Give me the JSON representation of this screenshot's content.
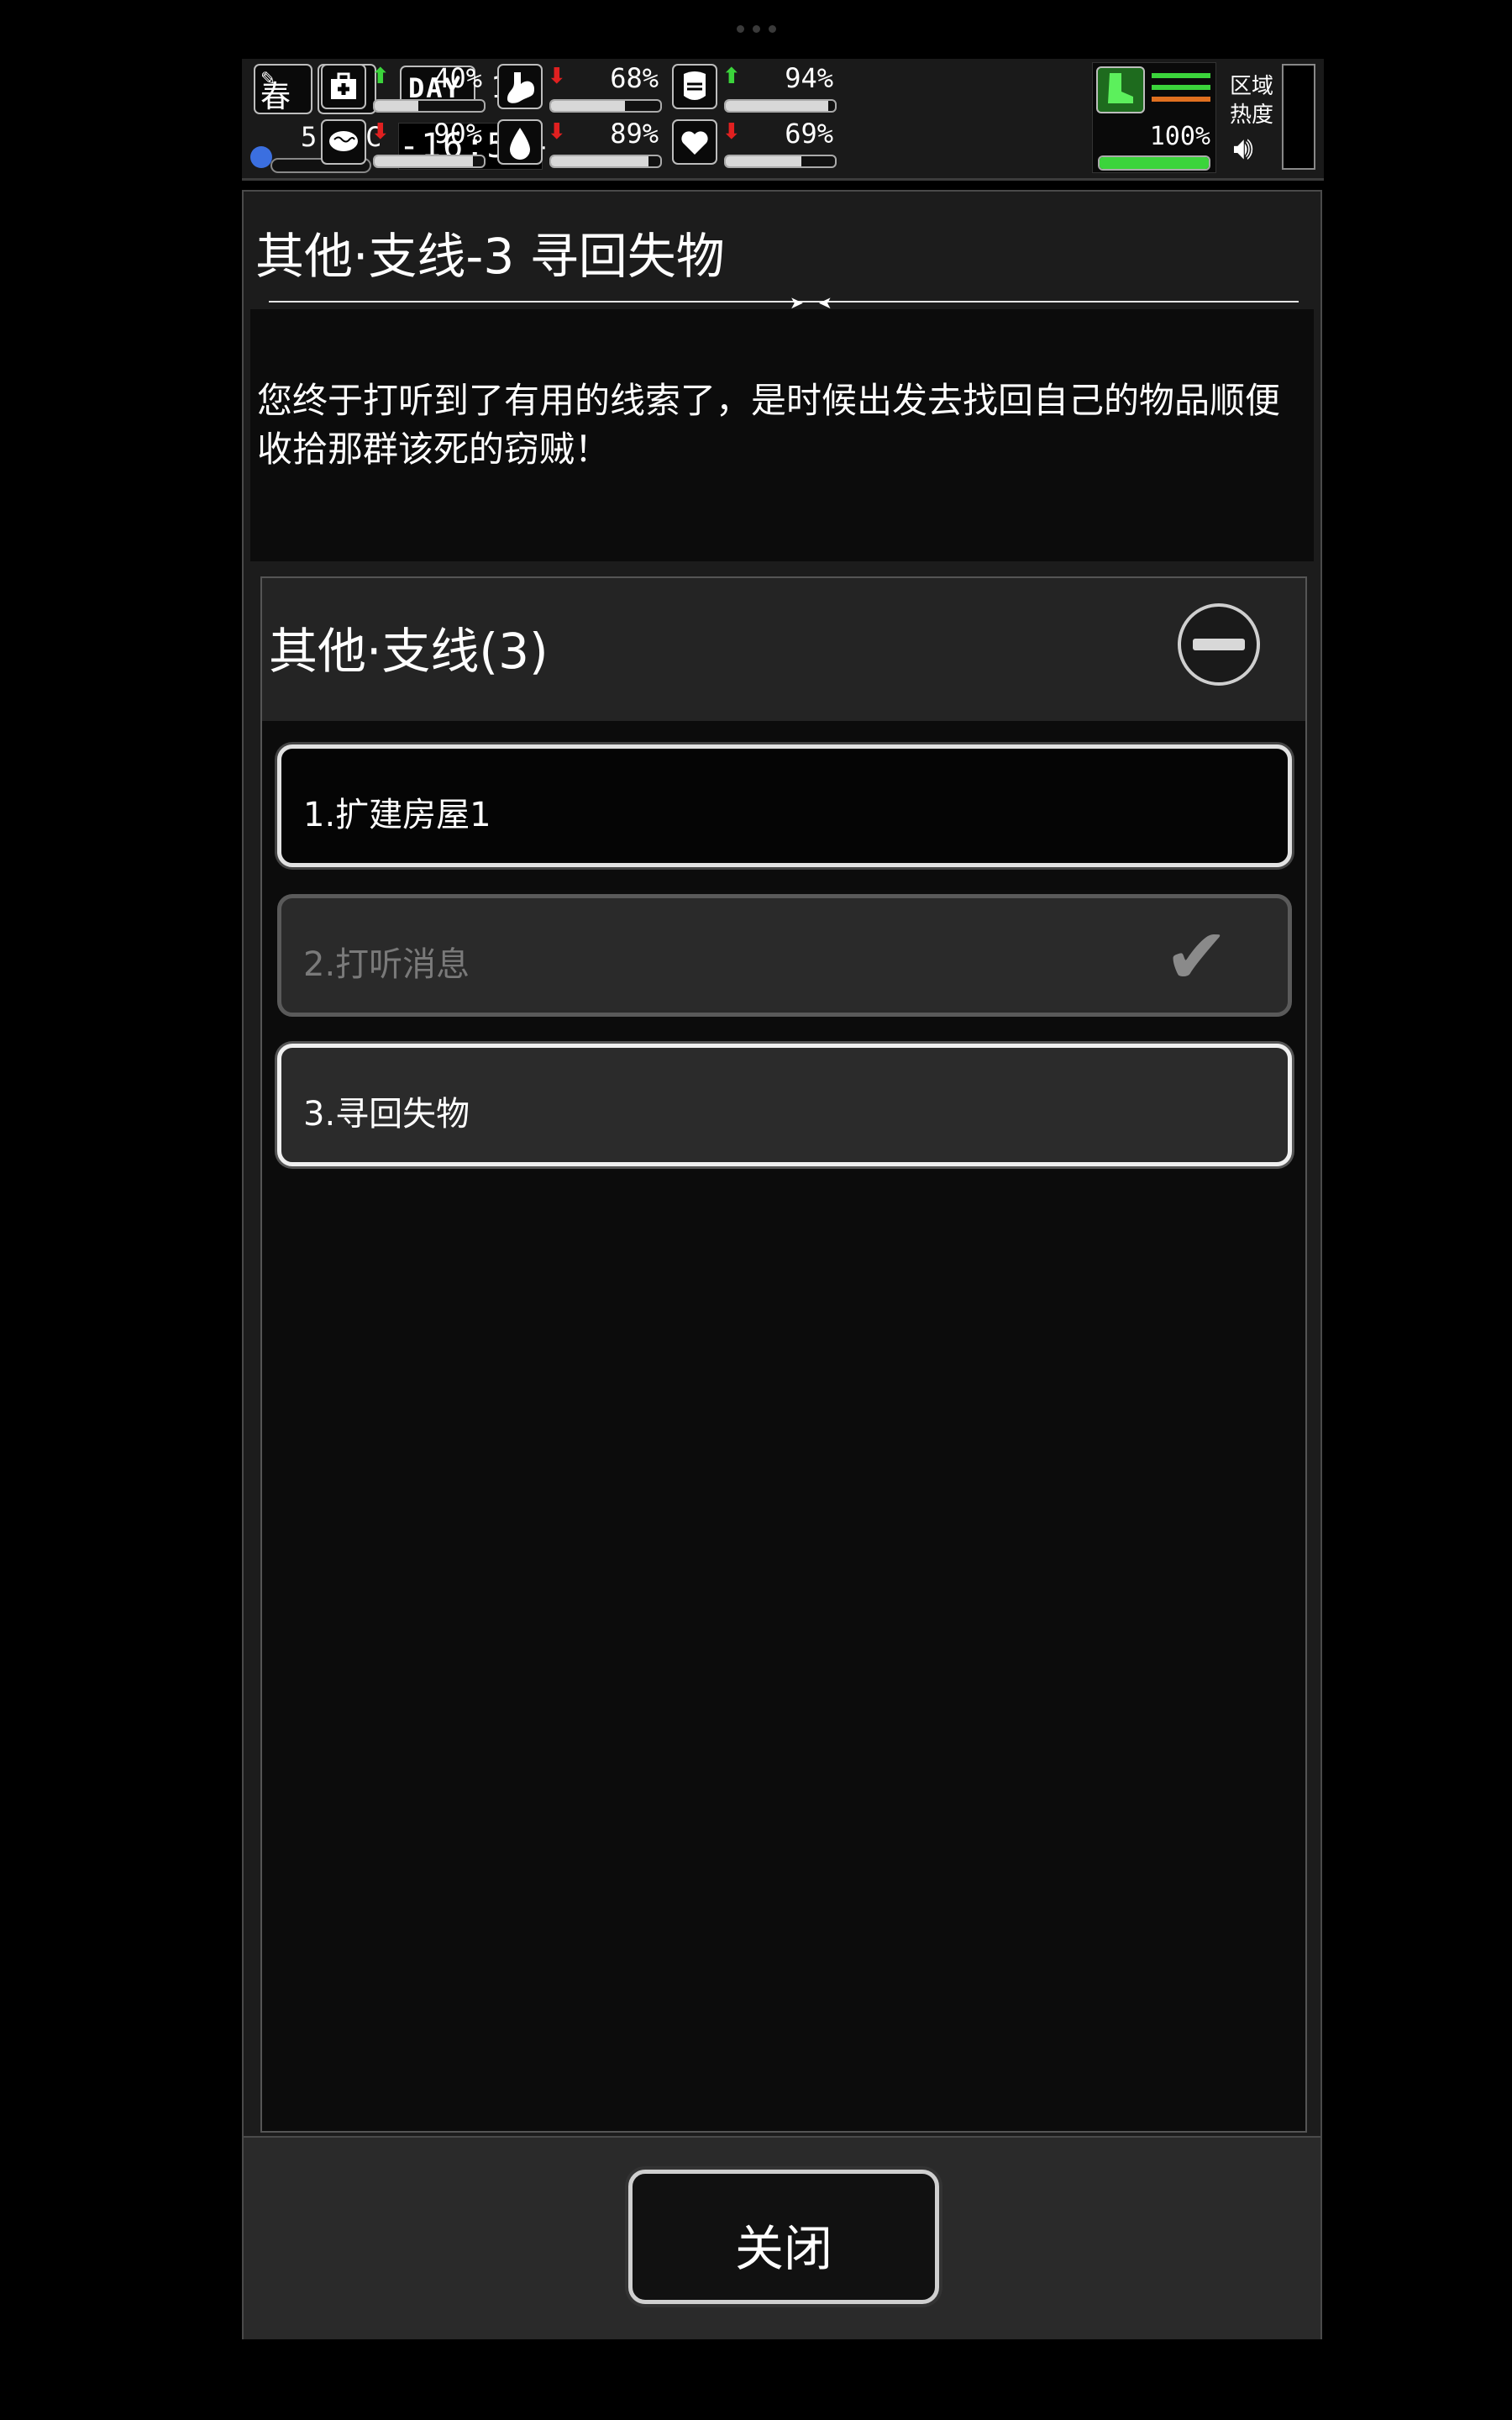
{
  "hud": {
    "season": "春",
    "temperature": "5.0°C",
    "day_label": "DAY",
    "day_number": "13",
    "time": "-16:50-",
    "stats": [
      {
        "name": "health-icon",
        "trend": "up",
        "trend_symbol": "⬆",
        "value": "40%",
        "fill": 0.4
      },
      {
        "name": "stomach-icon",
        "trend": "down",
        "trend_symbol": "⬇",
        "value": "68%",
        "fill": 0.68
      },
      {
        "name": "armor-icon",
        "trend": "up",
        "trend_symbol": "⬆",
        "value": "94%",
        "fill": 0.94
      },
      {
        "name": "brain-icon",
        "trend": "down",
        "trend_symbol": "⬇",
        "value": "90%",
        "fill": 0.9
      },
      {
        "name": "water-icon",
        "trend": "down",
        "trend_symbol": "⬇",
        "value": "89%",
        "fill": 0.89
      },
      {
        "name": "heart-icon",
        "trend": "down",
        "trend_symbol": "⬇",
        "value": "69%",
        "fill": 0.69
      }
    ],
    "stamina": "100%",
    "area_label": "区域热度"
  },
  "quest": {
    "title": "其他·支线-3 寻回失物",
    "description": "您终于打听到了有用的线索了，是时候出发去找回自己的物品顺便收拾那群该死的窃贼！"
  },
  "chapter": {
    "title": "其他·支线(3)",
    "items": [
      {
        "label": "1.扩建房屋1",
        "state": "active"
      },
      {
        "label": "2.打听消息",
        "state": "done"
      },
      {
        "label": "3.寻回失物",
        "state": "current"
      }
    ]
  },
  "footer": {
    "close_label": "关闭"
  },
  "colors": {
    "up": "#3bd43b",
    "down": "#e02020",
    "stamina": "#3bd43b"
  }
}
